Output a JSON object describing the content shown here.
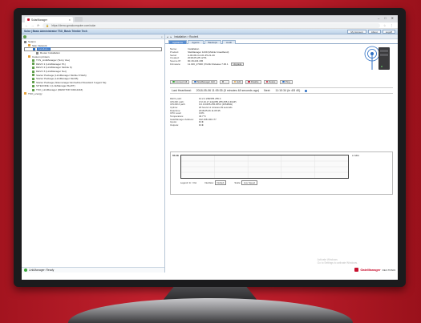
{
  "browser": {
    "tab_title": "SolarManager",
    "url": "https://demo.gmalcomputer.com/solar",
    "window_controls": [
      "–",
      "□",
      "✕"
    ]
  },
  "app_header": {
    "title": "Solar | Basic Administrator TSO_Basic Trimble Tech",
    "buttons": [
      "My Account",
      "About",
      "Logoff"
    ]
  },
  "left": {
    "tree": [
      {
        "label": "Solarm",
        "indent": 0,
        "color": "#7a7a7a"
      },
      {
        "label": "Stat. Network",
        "indent": 1,
        "color": "#e6a23c"
      },
      {
        "label": "Installation",
        "indent": 2,
        "color": "#2d6fc4",
        "selected": true
      },
      {
        "label": "Router Installation",
        "indent": 3,
        "color": "#888"
      },
      {
        "label": "Custom printers",
        "indent": 1,
        "color": "#e6a23c"
      },
      {
        "label": "TVS_LinkManager (Temy Vee)",
        "indent": 2,
        "color": "#5f9e4b"
      },
      {
        "label": "DEVO 1 (LinkManager P1)",
        "indent": 2,
        "color": "#5f9e4b"
      },
      {
        "label": "DEVO 2 (LinkManager Mobile 6)",
        "indent": 2,
        "color": "#5f9e4b"
      },
      {
        "label": "DEVO 3 (LinkManager Net)",
        "indent": 2,
        "color": "#5f9e4b"
      },
      {
        "label": "Starter Package (LinkManager Mobile 8 Wah)",
        "indent": 2,
        "color": "#5f9e4b"
      },
      {
        "label": "Starter Package (LinkManager MoCB)",
        "indent": 2,
        "color": "#5f9e4b"
      },
      {
        "label": "Starter Package (Sitemanager Embedded Standard 3 agent 5a)",
        "indent": 2,
        "color": "#5f9e4b"
      },
      {
        "label": "SITECORE 1 (LinkManager BeWT)",
        "indent": 2,
        "color": "#5f9e4b"
      },
      {
        "label": "TSO_LinkManager (DESKTOP-KMA4443)",
        "indent": 2,
        "color": "#5f9e4b"
      },
      {
        "label": "TSO_energy",
        "indent": 0,
        "color": "#e6a23c"
      }
    ],
    "status": "LinkManager: Ready"
  },
  "right": {
    "breadcrumb": "Installation > Router4",
    "tabs": [
      "Appliance",
      "Agents",
      "Backups",
      "Audit"
    ],
    "active_tab": 0,
    "details": [
      {
        "k": "Name:",
        "v": "Installation"
      },
      {
        "k": "Product:",
        "v": "SiteManager 1239 (Mobile broadband)"
      },
      {
        "k": "Serial:",
        "v": "A-00-0D-CA-01-35-21-4C"
      },
      {
        "k": "Created:",
        "v": "2018-05-28 12:51"
      },
      {
        "k": "Source IP:",
        "v": "90.18.223.165"
      },
      {
        "k": "Firmware:",
        "v": "11.016_27000 | Public Release 7.00.1"
      }
    ],
    "upgrade_label": "Upgrade",
    "actions": [
      {
        "label": "Connect All",
        "color": "#3aa63a"
      },
      {
        "label": "SiteManager GUI",
        "color": "#2d6fc4"
      },
      {
        "label": "...",
        "color": "#777"
      },
      {
        "label": "Edit",
        "color": "#e6a23c"
      },
      {
        "label": "Disable",
        "color": "#c8102e"
      },
      {
        "label": "Delete",
        "color": "#c8102e"
      },
      {
        "label": "Ping",
        "color": "#2d6fc4"
      }
    ],
    "heartbeat": {
      "last_label": "Last Heartbeat:",
      "last_value": "2018-05-06 11:05:35 (5 minutes 48 seconds ago)",
      "next_label": "Next:",
      "next_value": "11:10:34 (in 4/5 40)"
    },
    "info": [
      {
        "k": "DEV1 path:",
        "v": "10.2.2.238/255.255.0"
      },
      {
        "k": "UPLINK path:",
        "v": "172.16.17.144/255.255.255.0 (DHP)"
      },
      {
        "k": "UPLINK2 path:",
        "v": "0.0.0.0/255.255.255.0 (DISMSH)"
      },
      {
        "k": "Uptime:",
        "v": "20 hours 11 minutes 29 seconds"
      },
      {
        "k": "Date/time:",
        "v": "2018-05-06 11:05:35"
      },
      {
        "k": "CPU Load:",
        "v": "3.0%"
      },
      {
        "k": "Temperature:",
        "v": "40.7°C"
      },
      {
        "k": "GateManager Address:",
        "v": "192.168.100.177"
      },
      {
        "k": "Inputs:",
        "v": "⊗ ⊗"
      },
      {
        "k": "Outputs:",
        "v": "⊗ ⊗"
      }
    ],
    "chart": {
      "ylabel": "55.5K",
      "unit": "in Mbit",
      "legend_label": "Legend:",
      "legend_value": "In / Out",
      "interface_label": "Interface:",
      "interface_value": "Default",
      "scale_label": "Scale:",
      "scale_value": "Live Speed"
    },
    "watermark_line1": "Activate Windows",
    "watermark_line2": "Go to Settings to activate Windows.",
    "brand": "GateManager",
    "brand_sub": "DEV-TDS03"
  },
  "colors": {
    "background": "#b41d2a",
    "accent": "#2d6fc4",
    "brand": "#c8102e"
  }
}
